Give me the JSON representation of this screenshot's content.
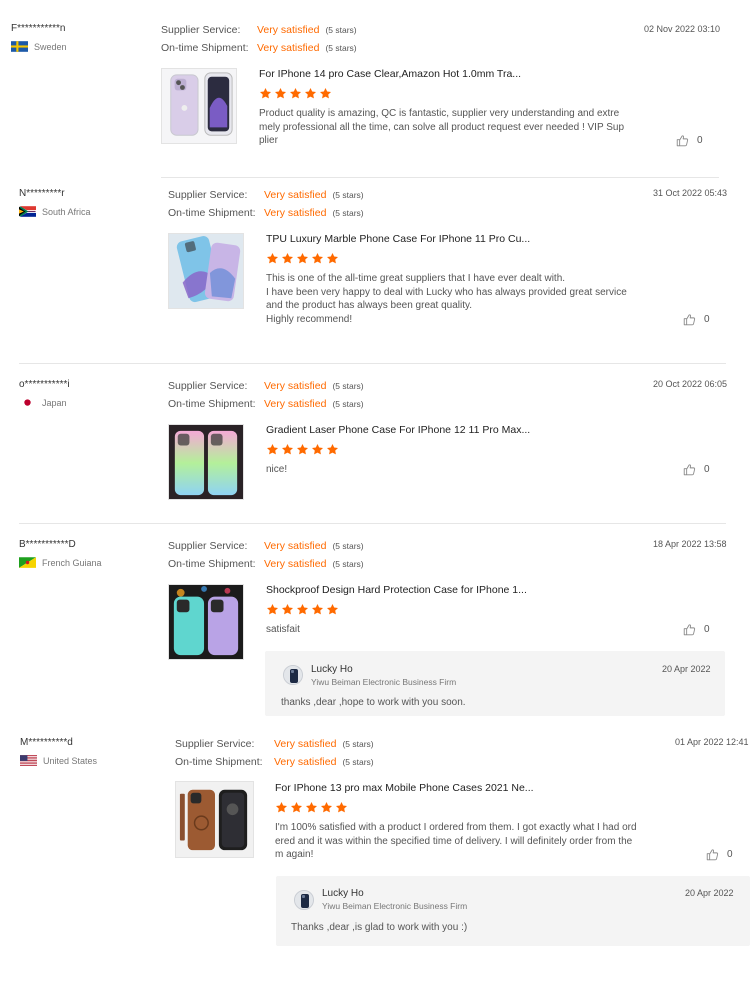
{
  "labels": {
    "supplier_service": "Supplier Service:",
    "ontime_shipment": "On-time Shipment:"
  },
  "colors": {
    "accent": "#ff6a00",
    "divider": "#e6e6e6",
    "reply_bg": "#f4f4f4"
  },
  "reviews": [
    {
      "reviewer": "F***********n",
      "country": "Sweden",
      "flag": "sweden-flag",
      "supplier_service": "Very satisfied",
      "supplier_stars": "(5 stars)",
      "shipment": "Very satisfied",
      "shipment_stars": "(5 stars)",
      "date": "02 Nov 2022 03:10",
      "product_title": "For IPhone 14 pro Case Clear,Amazon Hot 1.0mm Tra...",
      "rating": 5,
      "comment_lines": [
        "Product quality is amazing, QC is fantastic, supplier very understanding and extre",
        "mely professional all the time, can solve all product request ever needed ! VIP Sup",
        "plier"
      ],
      "likes": "0"
    },
    {
      "reviewer": "N*********r",
      "country": "South Africa",
      "flag": "south-africa-flag",
      "supplier_service": "Very satisfied",
      "supplier_stars": "(5 stars)",
      "shipment": "Very satisfied",
      "shipment_stars": "(5 stars)",
      "date": "31 Oct 2022 05:43",
      "product_title": "TPU Luxury Marble Phone Case For IPhone 11 Pro Cu...",
      "rating": 5,
      "comment_lines": [
        "This is one of the all-time great suppliers that I have ever dealt with.",
        "I have been very happy to deal with Lucky who has always provided great service",
        "and the product has always been great quality.",
        "Highly recommend!"
      ],
      "likes": "0"
    },
    {
      "reviewer": "o***********i",
      "country": "Japan",
      "flag": "japan-flag",
      "supplier_service": "Very satisfied",
      "supplier_stars": "(5 stars)",
      "shipment": "Very satisfied",
      "shipment_stars": "(5 stars)",
      "date": "20 Oct 2022 06:05",
      "product_title": "Gradient Laser Phone Case For IPhone 12 11 Pro Max...",
      "rating": 5,
      "comment_lines": [
        "nice!"
      ],
      "likes": "0"
    },
    {
      "reviewer": "B***********D",
      "country": "French Guiana",
      "flag": "french-guiana-flag",
      "supplier_service": "Very satisfied",
      "supplier_stars": "(5 stars)",
      "shipment": "Very satisfied",
      "shipment_stars": "(5 stars)",
      "date": "18 Apr 2022 13:58",
      "product_title": "Shockproof Design Hard Protection Case for IPhone 1...",
      "rating": 5,
      "comment_lines": [
        "satisfait"
      ],
      "likes": "0",
      "reply": {
        "name": "Lucky Ho",
        "company": "Yiwu Beiman Electronic Business Firm",
        "date": "20 Apr 2022",
        "text": "thanks ,dear ,hope to work with you soon."
      }
    },
    {
      "reviewer": "M**********d",
      "country": "United States",
      "flag": "united-states-flag",
      "supplier_service": "Very satisfied",
      "supplier_stars": "(5 stars)",
      "shipment": "Very satisfied",
      "shipment_stars": "(5 stars)",
      "date": "01 Apr 2022 12:41",
      "product_title": "For IPhone 13 pro max Mobile Phone Cases 2021 Ne...",
      "rating": 5,
      "comment_lines": [
        "I'm 100% satisfied with a product I ordered from them. I got exactly what I had ord",
        "ered and it was within the specified time of delivery. I will definitely order from the",
        "m again!"
      ],
      "likes": "0",
      "reply": {
        "name": "Lucky Ho",
        "company": "Yiwu Beiman Electronic Business Firm",
        "date": "20 Apr 2022",
        "text": "Thanks ,dear ,is glad to work with you :)"
      }
    }
  ]
}
